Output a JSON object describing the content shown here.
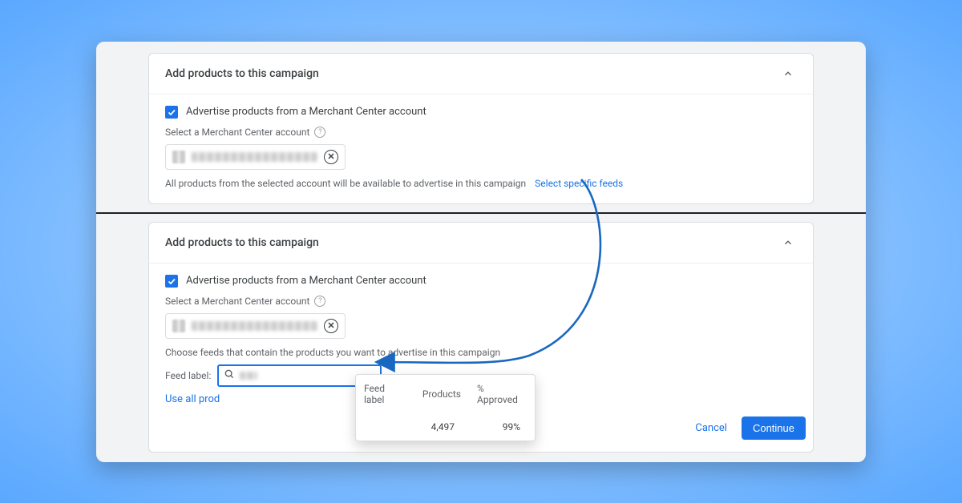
{
  "top_card": {
    "title": "Add products to this campaign",
    "checkbox_label": "Advertise products from a Merchant Center account",
    "select_label": "Select a Merchant Center account",
    "desc": "All products from the selected account will be available to advertise in this campaign",
    "link": "Select specific feeds"
  },
  "bottom_card": {
    "title": "Add products to this campaign",
    "checkbox_label": "Advertise products from a Merchant Center account",
    "select_label": "Select a Merchant Center account",
    "desc": "Choose feeds that contain the products you want to advertise in this campaign",
    "feed_label": "Feed label:",
    "use_all": "Use all prod"
  },
  "dropdown": {
    "headers": {
      "c1": "Feed label",
      "c2": "Products",
      "c3": "% Approved"
    },
    "row": {
      "products": "4,497",
      "approved": "99%"
    }
  },
  "footer": {
    "cancel": "Cancel",
    "continue": "Continue"
  }
}
